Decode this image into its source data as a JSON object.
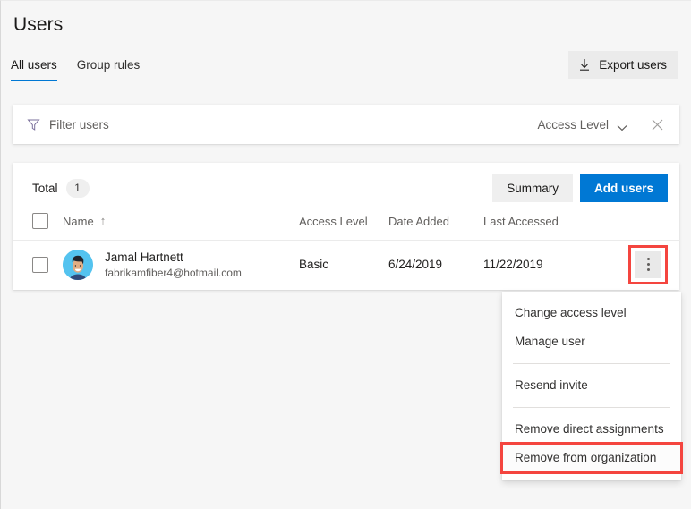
{
  "header": {
    "title": "Users",
    "tabs": [
      {
        "label": "All users",
        "active": true
      },
      {
        "label": "Group rules",
        "active": false
      }
    ],
    "export_button": {
      "label": "Export users",
      "icon": "download-icon"
    }
  },
  "filter_bar": {
    "icon": "funnel-icon",
    "label": "Filter users",
    "access_level_filter": {
      "label": "Access Level",
      "icon": "chevron-down-icon"
    },
    "clear_icon": "close-icon"
  },
  "grid": {
    "total_label": "Total",
    "total_count": "1",
    "summary_button": "Summary",
    "add_users_button": "Add users",
    "columns": [
      {
        "key": "check",
        "label": ""
      },
      {
        "key": "name",
        "label": "Name",
        "sort": "↑"
      },
      {
        "key": "access_level",
        "label": "Access Level"
      },
      {
        "key": "date_added",
        "label": "Date Added"
      },
      {
        "key": "last_accessed",
        "label": "Last Accessed"
      },
      {
        "key": "more",
        "label": ""
      }
    ],
    "rows": [
      {
        "name": "Jamal Hartnett",
        "email": "fabrikamfiber4@hotmail.com",
        "access_level": "Basic",
        "date_added": "6/24/2019",
        "last_accessed": "11/22/2019",
        "avatar": "user-avatar",
        "more_icon": "more-vertical-icon"
      }
    ]
  },
  "context_menu": {
    "items": [
      {
        "label": "Change access level",
        "type": "item"
      },
      {
        "label": "Manage user",
        "type": "item"
      },
      {
        "label": "",
        "type": "separator"
      },
      {
        "label": "Resend invite",
        "type": "item"
      },
      {
        "label": "",
        "type": "separator"
      },
      {
        "label": "Remove direct assignments",
        "type": "item"
      },
      {
        "label": "Remove from organization",
        "type": "item",
        "highlighted": true
      }
    ]
  },
  "colors": {
    "accent": "#0078d4",
    "highlight": "#f4453f",
    "page_background": "#f6f6f6",
    "card_background": "#ffffff",
    "avatar_background": "#54c3ef"
  }
}
